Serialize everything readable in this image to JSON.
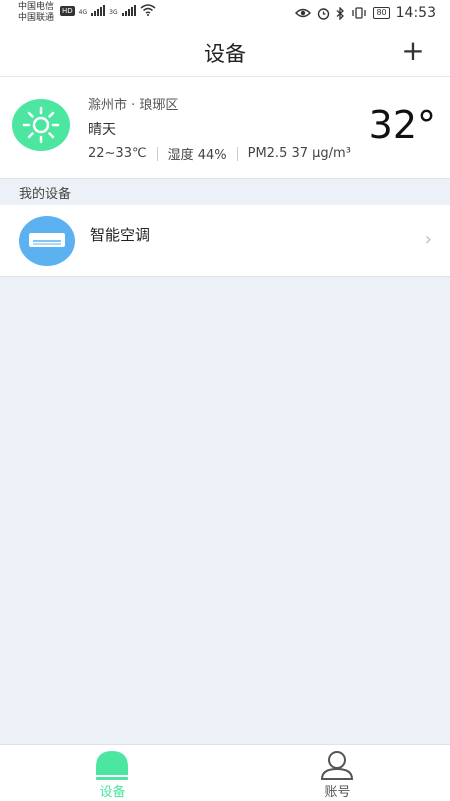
{
  "status_bar": {
    "carrier_1": "中国电信",
    "carrier_2": "中国联通",
    "hd_badge": "HD",
    "signal_1_label": "4G",
    "signal_2_label": "3G",
    "battery": "80",
    "time": "14:53"
  },
  "header": {
    "title": "设备",
    "add_label": "+"
  },
  "weather": {
    "location": "滁州市 · 琅琊区",
    "condition": "晴天",
    "temp_range": "22~33℃",
    "humidity": "湿度 44%",
    "pm25": "PM2.5 37 μg/m³",
    "temperature": "32°",
    "icon": "sun-icon"
  },
  "my_devices": {
    "section_title": "我的设备",
    "items": [
      {
        "name": "智能空调",
        "icon": "air-conditioner-icon"
      }
    ]
  },
  "tabbar": {
    "tabs": [
      {
        "label": "设备",
        "icon": "device-icon",
        "active": true
      },
      {
        "label": "账号",
        "icon": "person-icon",
        "active": false
      }
    ]
  },
  "colors": {
    "accent_green": "#4ce6a0",
    "device_blue": "#5cb1f1",
    "background": "#ecf1f7",
    "inactive_tab": "#555555"
  }
}
